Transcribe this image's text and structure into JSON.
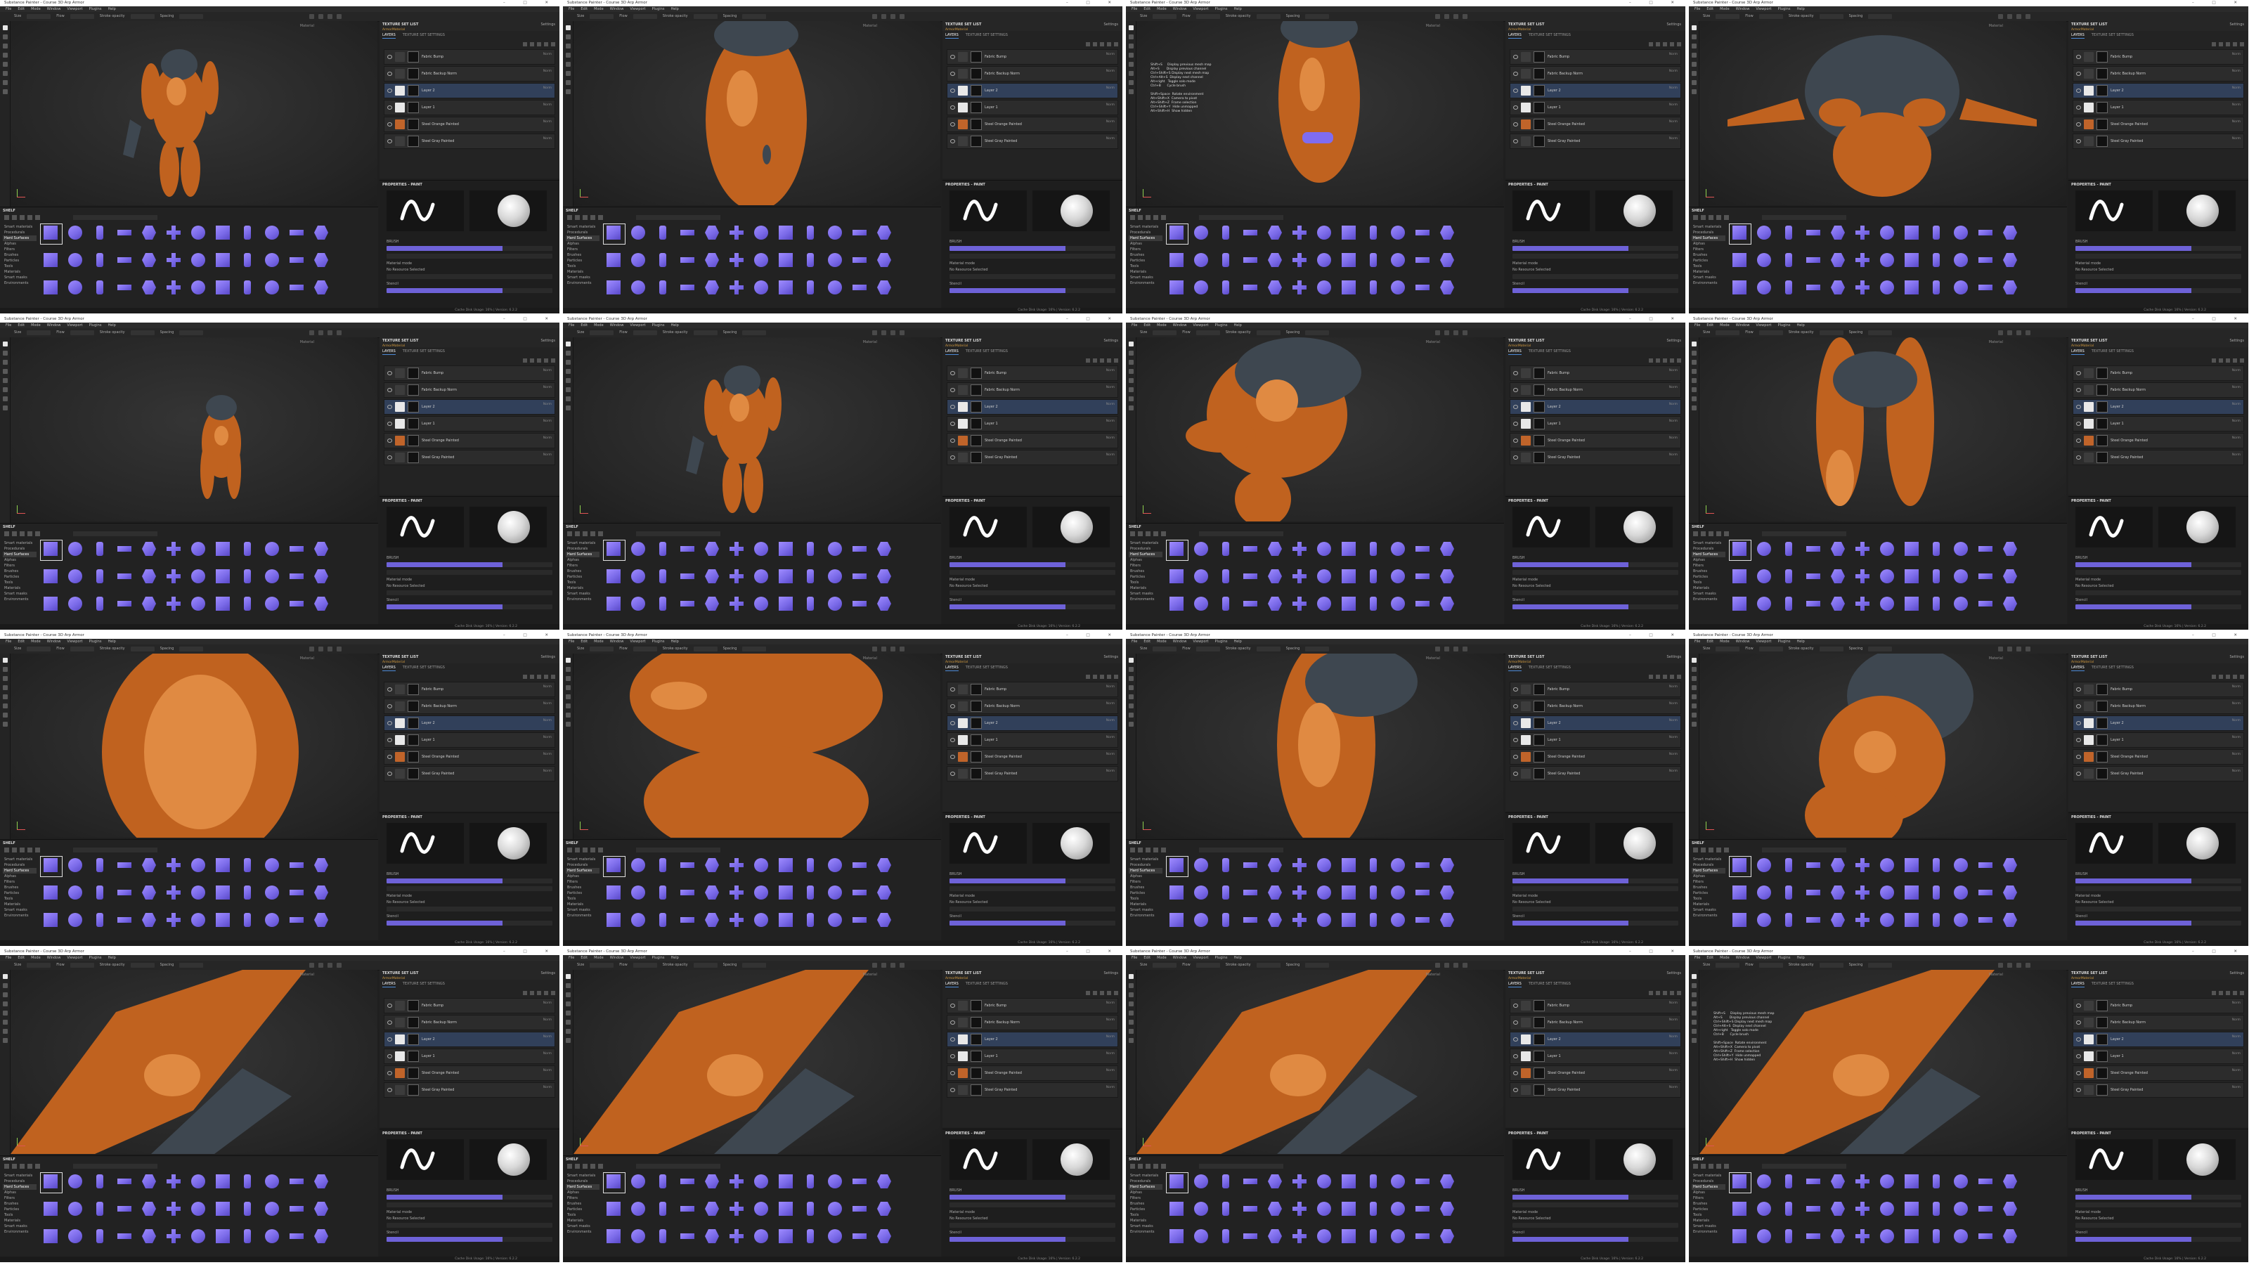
{
  "window_title": "Substance Painter - Course 3D Arp Armor",
  "window_controls": [
    "–",
    "□",
    "✕"
  ],
  "menu": [
    "File",
    "Edit",
    "Mode",
    "Window",
    "Viewport",
    "Plugins",
    "Help"
  ],
  "toolbar": {
    "size_label": "Size",
    "flow_label": "Flow",
    "stroke_opacity_label": "Stroke opacity",
    "spacing_label": "Spacing"
  },
  "viewport": {
    "view_mode": "Material"
  },
  "texture_set_list": {
    "title": "TEXTURE SET LIST",
    "settings_label": "Settings",
    "current_set": "ArmorMaterial"
  },
  "layers_panel": {
    "tabs": [
      "LAYERS",
      "TEXTURE SET SETTINGS"
    ],
    "layers": [
      {
        "name": "Fabric Bump",
        "blend": "Norm",
        "thumb": "dark"
      },
      {
        "name": "Fabric Backup Norm",
        "blend": "Norm",
        "thumb": "dark"
      },
      {
        "name": "Layer 2",
        "blend": "Norm",
        "thumb": "white"
      },
      {
        "name": "Layer 1",
        "blend": "Norm",
        "thumb": "white"
      },
      {
        "name": "Steel Orange Painted",
        "blend": "Norm",
        "thumb": "orange"
      },
      {
        "name": "Steel Gray Painted",
        "blend": "Norm",
        "thumb": "dark"
      }
    ]
  },
  "properties_panel": {
    "title": "PROPERTIES - PAINT",
    "brush_label": "BRUSH",
    "alpha_label": "ALPHA",
    "material_label": "Material mode",
    "material_hint": "No Resource Selected",
    "stencil_label": "Stencil"
  },
  "shelf": {
    "title": "SHELF",
    "search_placeholder": "Search...",
    "categories": [
      "Smart materials",
      "Procedurals",
      "Hard Surfaces",
      "Alphas",
      "Filters",
      "Brushes",
      "Particles",
      "Tools",
      "Materials",
      "Smart masks",
      "Environments"
    ],
    "active_category": "Hard Surfaces"
  },
  "status_bar": "Cache Disk Usage: 16%  |  Version: 6.2.2",
  "tiles": [
    {
      "view": "full-body",
      "shortcut_overlay": false
    },
    {
      "view": "torso-side",
      "shortcut_overlay": false
    },
    {
      "view": "torso-front",
      "shortcut_overlay": true
    },
    {
      "view": "back",
      "shortcut_overlay": false
    },
    {
      "view": "full-body-small",
      "shortcut_overlay": false
    },
    {
      "view": "full-body-side",
      "shortcut_overlay": false
    },
    {
      "view": "upper-legs",
      "shortcut_overlay": false
    },
    {
      "view": "legs-front",
      "shortcut_overlay": false
    },
    {
      "view": "thigh-close",
      "shortcut_overlay": false
    },
    {
      "view": "hip-close",
      "shortcut_overlay": false
    },
    {
      "view": "shin-close",
      "shortcut_overlay": false
    },
    {
      "view": "knee-close",
      "shortcut_overlay": false
    },
    {
      "view": "leg-diag",
      "shortcut_overlay": false
    },
    {
      "view": "leg-diag-2",
      "shortcut_overlay": false
    },
    {
      "view": "leg-diag-3",
      "shortcut_overlay": false
    },
    {
      "view": "leg-diag-4",
      "shortcut_overlay": true
    }
  ],
  "shortcut_overlay_text": "Shift+S     Display previous mesh map\nAlt+S       Display previous channel\nCtrl+Shift+S Display next mesh map\nCtrl+Alt+S  Display next channel\nAlt+right   Toggle solo mode\nCtrl+B      Cycle brush\n\nShift+Space  Rotate environment\nAlt+Shift+X  Camera to pivot\nAlt+Shift+Z  Frame selection\nCtrl+Shift+Y  Hide unmapped\nAlt+Shift+H  Show hidden",
  "colors": {
    "armor_orange": "#c0621f",
    "armor_steel": "#3e4750",
    "brush_purple": "#7a6ae8",
    "panel_bg": "#232323",
    "viewport_bg": "#2c2c2c",
    "accent_blue": "#4c8ad6"
  },
  "icons": [
    "move-icon",
    "paint-brush-icon",
    "eraser-icon",
    "projection-icon",
    "polygon-fill-icon",
    "smudge-icon",
    "clone-icon",
    "color-picker-icon",
    "eye-icon",
    "folder-icon",
    "add-layer-icon",
    "mask-icon",
    "sphere-preview-icon"
  ]
}
